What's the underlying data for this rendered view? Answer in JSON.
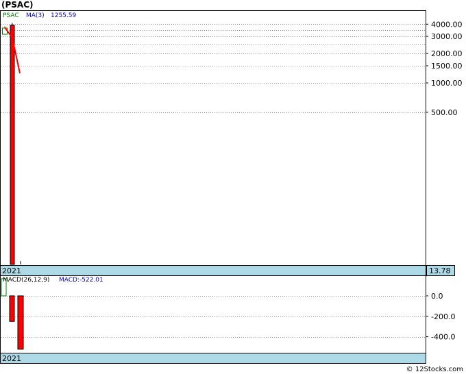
{
  "title": "(PSAC)",
  "copyright": "© 12Stocks.com",
  "colors": {
    "grid": "#999999",
    "band": "#add8e6",
    "up": "#008000",
    "down": "#ff0000",
    "ma_line": "#ff0000",
    "ticker_text": "#008000",
    "ma_text": "#0000cc",
    "macd_text": "#0000cc"
  },
  "chart_data": [
    {
      "type": "candlestick",
      "panel": "price",
      "legend": {
        "ticker": "PSAC",
        "ma_label": "MA(3)",
        "ma_value": "1255.59"
      },
      "y_scale": "log",
      "ylim": [
        13.78,
        4500
      ],
      "y_ticks": [
        {
          "label": "4000.00",
          "value": 4000
        },
        {
          "label": "3000.00",
          "value": 3000
        },
        {
          "label": "2000.00",
          "value": 2000
        },
        {
          "label": "1500.00",
          "value": 1500
        },
        {
          "label": "1000.00",
          "value": 1000
        },
        {
          "label": "500.00",
          "value": 500
        }
      ],
      "gridlines": [
        4000,
        3500,
        3000,
        2500,
        2000,
        1500,
        1000,
        500
      ],
      "last_price_label": "13.78",
      "x_label": "2021",
      "candles": [
        {
          "open": 3150,
          "close": 3650,
          "high": 3800,
          "low": 3100,
          "direction": "up"
        },
        {
          "open": 3900,
          "close": 13.78,
          "high": 4100,
          "low": 13.78,
          "direction": "down"
        }
      ],
      "ma_line": [
        3700,
        2900,
        1255.59
      ]
    },
    {
      "type": "bar",
      "panel": "macd",
      "legend": {
        "label": "MACD(26,12,9)",
        "value_label": "MACD:-522.01"
      },
      "ylim": [
        -550,
        100
      ],
      "y_ticks": [
        {
          "label": "0.0",
          "value": 0
        },
        {
          "label": "-200.0",
          "value": -200
        },
        {
          "label": "-400.0",
          "value": -400
        }
      ],
      "x_label": "2021",
      "bars": [
        {
          "value": 0,
          "top": 0,
          "bottom": -0.5,
          "color": "up",
          "outline_top": 20
        },
        {
          "value": -250,
          "color": "down"
        },
        {
          "value": -522.01,
          "color": "down"
        }
      ]
    }
  ]
}
